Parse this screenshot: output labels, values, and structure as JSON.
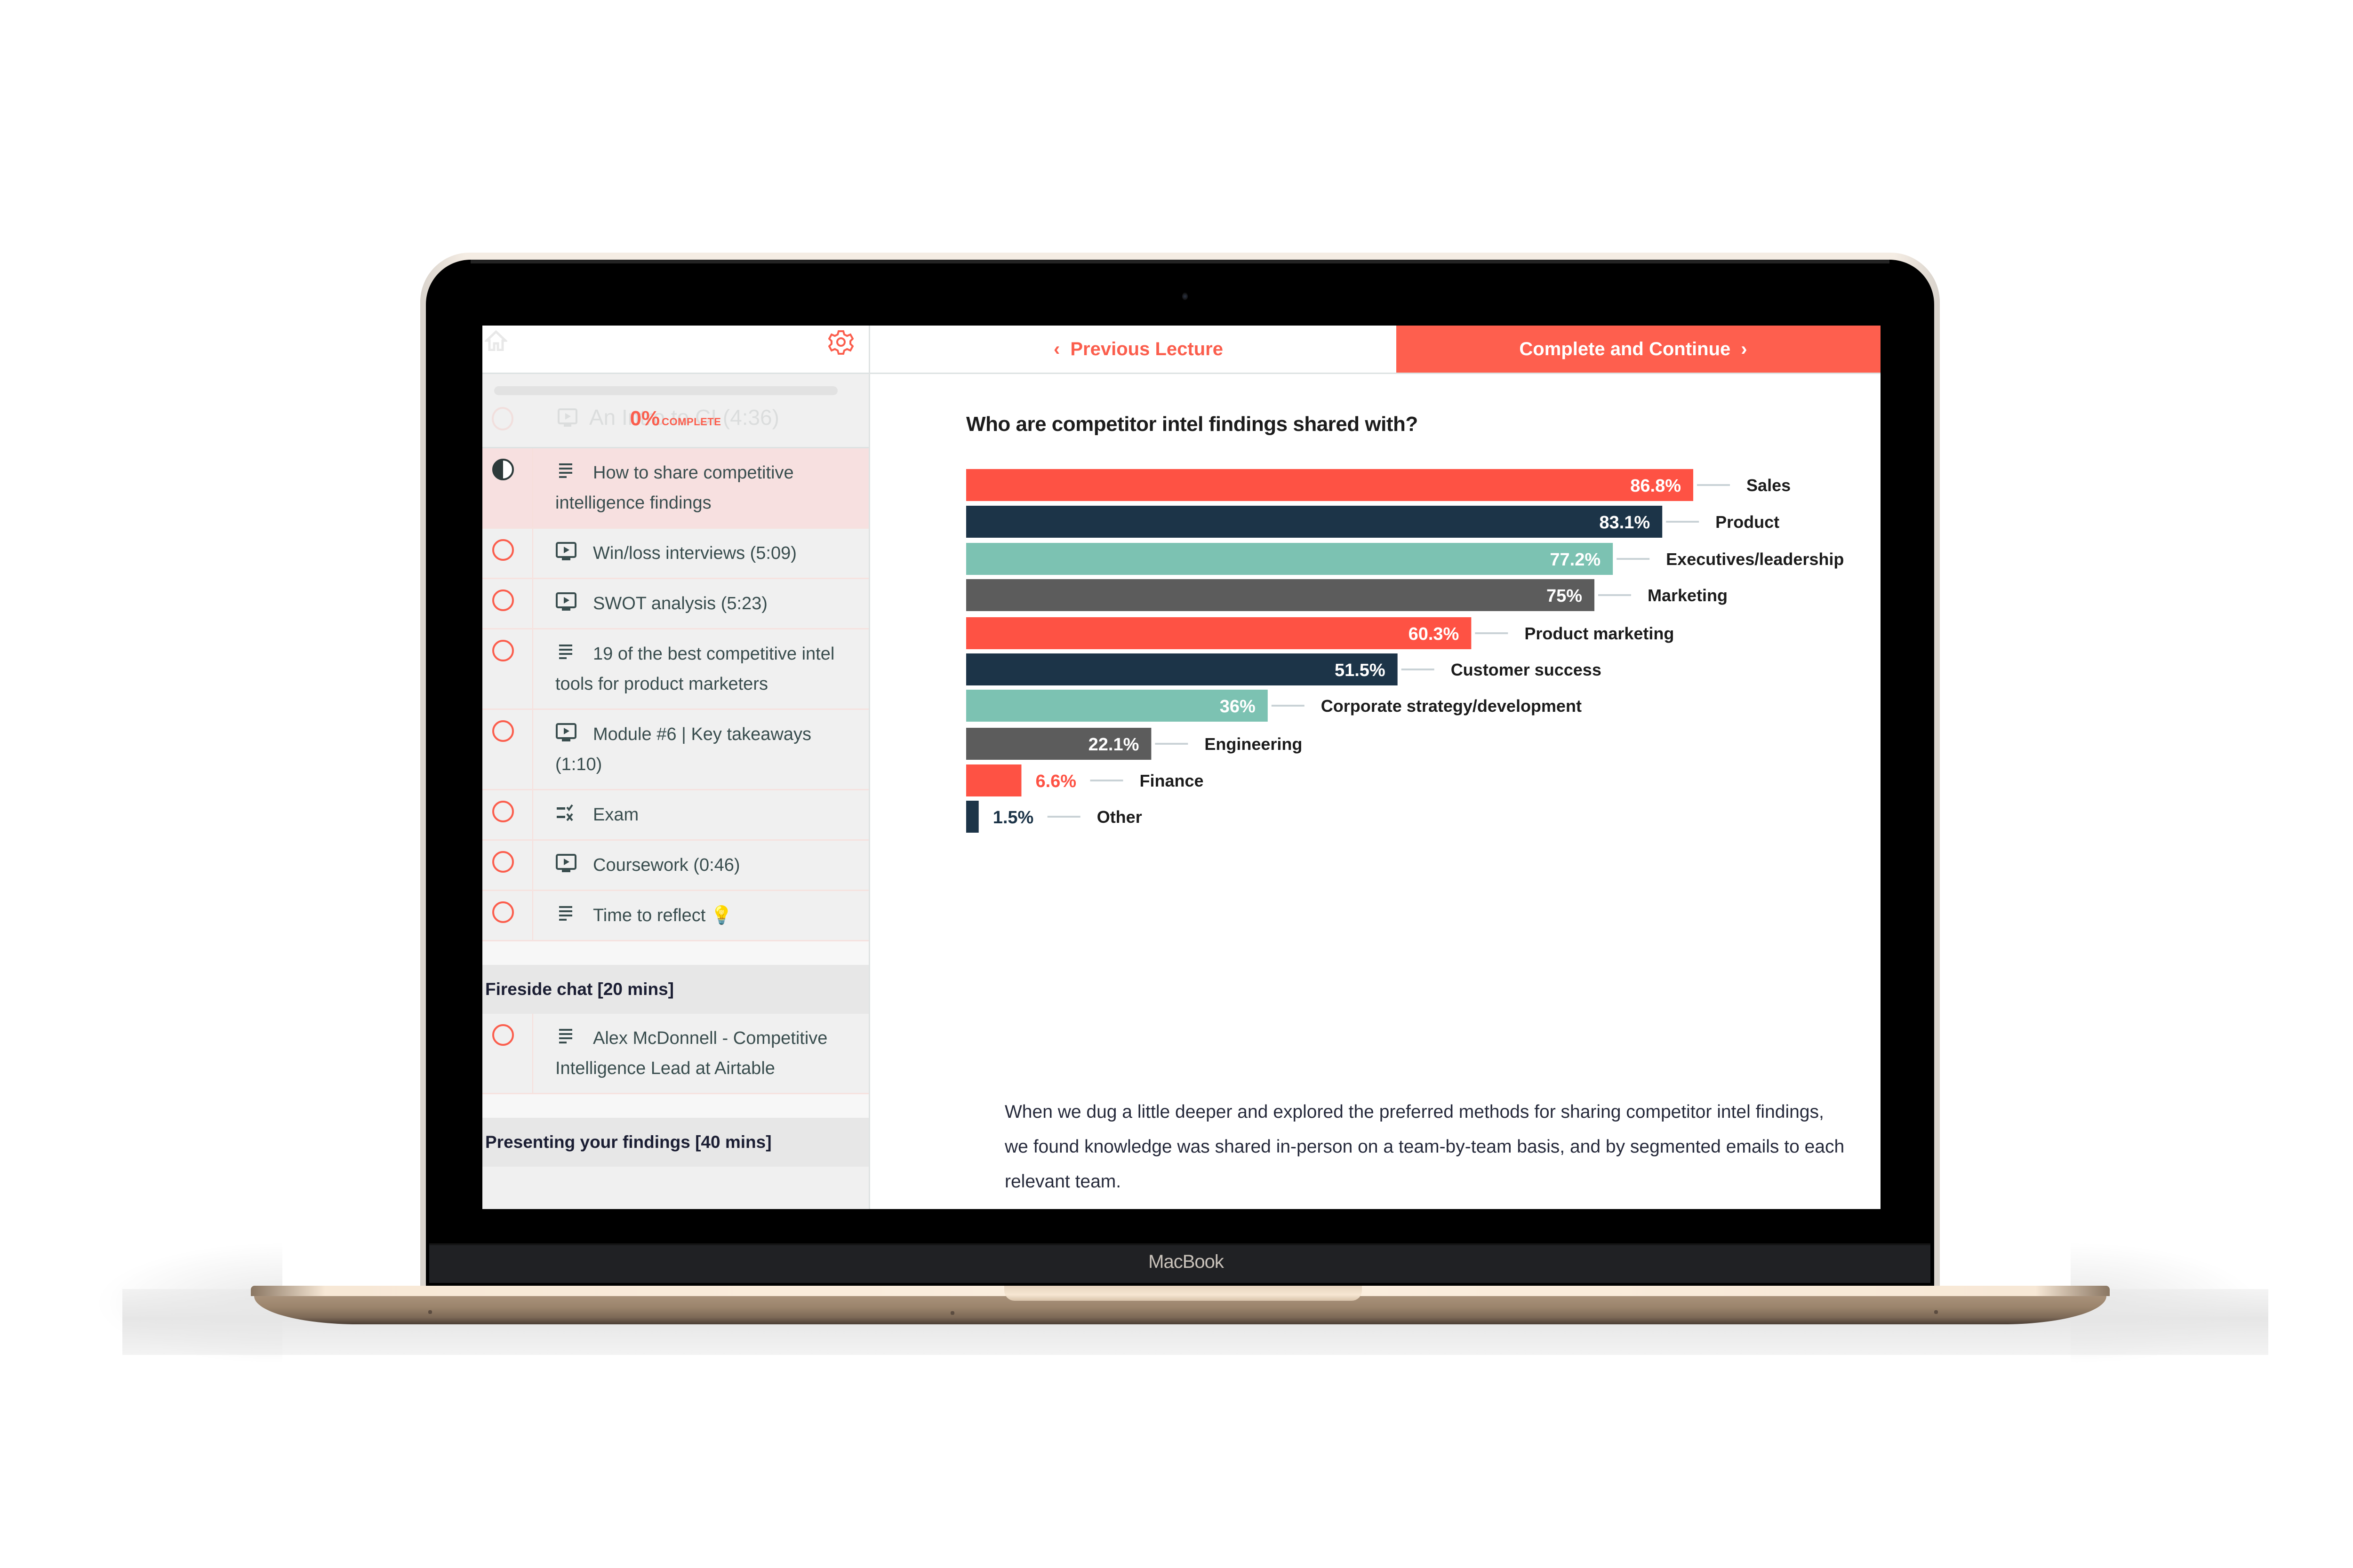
{
  "device": {
    "brand_label": "MacBook"
  },
  "sidebar": {
    "progress": {
      "percent": 0,
      "percent_label": "0%",
      "complete_label": "COMPLETE"
    },
    "ghost_item": {
      "title": "An Intro to CI (4:36)",
      "icon": "video-icon"
    },
    "items": [
      {
        "title": "How to share competitive intelligence findings",
        "icon": "text-icon",
        "status": "in-progress",
        "active": true
      },
      {
        "title": "Win/loss interviews (5:09)",
        "icon": "video-icon",
        "status": "incomplete",
        "active": false
      },
      {
        "title": "SWOT analysis (5:23)",
        "icon": "video-icon",
        "status": "incomplete",
        "active": false
      },
      {
        "title": "19 of the best competitive intel tools for product marketers",
        "icon": "text-icon",
        "status": "incomplete",
        "active": false
      },
      {
        "title": "Module #6 | Key takeaways (1:10)",
        "icon": "video-icon",
        "status": "incomplete",
        "active": false
      },
      {
        "title": "Exam",
        "icon": "quiz-icon",
        "status": "incomplete",
        "active": false
      },
      {
        "title": "Coursework (0:46)",
        "icon": "video-icon",
        "status": "incomplete",
        "active": false
      },
      {
        "title": "Time to reflect 💡",
        "icon": "text-icon",
        "status": "incomplete",
        "active": false
      }
    ],
    "sections": [
      {
        "title": "Fireside chat [20 mins]",
        "items": [
          {
            "title": "Alex McDonnell - Competitive Intelligence Lead at Airtable",
            "icon": "text-icon",
            "status": "incomplete",
            "active": false
          }
        ]
      },
      {
        "title": "Presenting your findings [40 mins]",
        "items": []
      }
    ]
  },
  "topbar": {
    "prev_label": "Previous Lecture",
    "next_label": "Complete and Continue"
  },
  "colors": {
    "accent": "#fe5f4e",
    "navy": "#1c3448",
    "teal": "#7cc2b2",
    "gray": "#5c5c5c"
  },
  "chart_data": {
    "type": "bar",
    "orientation": "horizontal",
    "title": "Who are competitor intel findings shared with?",
    "categories": [
      "Sales",
      "Product",
      "Executives/leadership",
      "Marketing",
      "Product marketing",
      "Customer success",
      "Corporate strategy/development",
      "Engineering",
      "Finance",
      "Other"
    ],
    "values": [
      86.8,
      83.1,
      77.2,
      75,
      60.3,
      51.5,
      36,
      22.1,
      6.6,
      1.5
    ],
    "value_labels": [
      "86.8%",
      "83.1%",
      "77.2%",
      "75%",
      "60.3%",
      "51.5%",
      "36%",
      "22.1%",
      "6.6%",
      "1.5%"
    ],
    "bar_colors": [
      "#fe5244",
      "#1c3448",
      "#7cc2b2",
      "#5c5c5c",
      "#fe5244",
      "#1c3448",
      "#7cc2b2",
      "#5c5c5c",
      "#fe5244",
      "#1c3448"
    ],
    "xlabel": "",
    "ylabel": "",
    "xlim": [
      0,
      100
    ],
    "grid": false,
    "legend": "none"
  },
  "article": {
    "paragraph": "When we dug a little deeper and explored the preferred methods for sharing competitor intel findings, we found knowledge was shared in-person on a team-by-team basis, and by segmented emails to each relevant team."
  }
}
